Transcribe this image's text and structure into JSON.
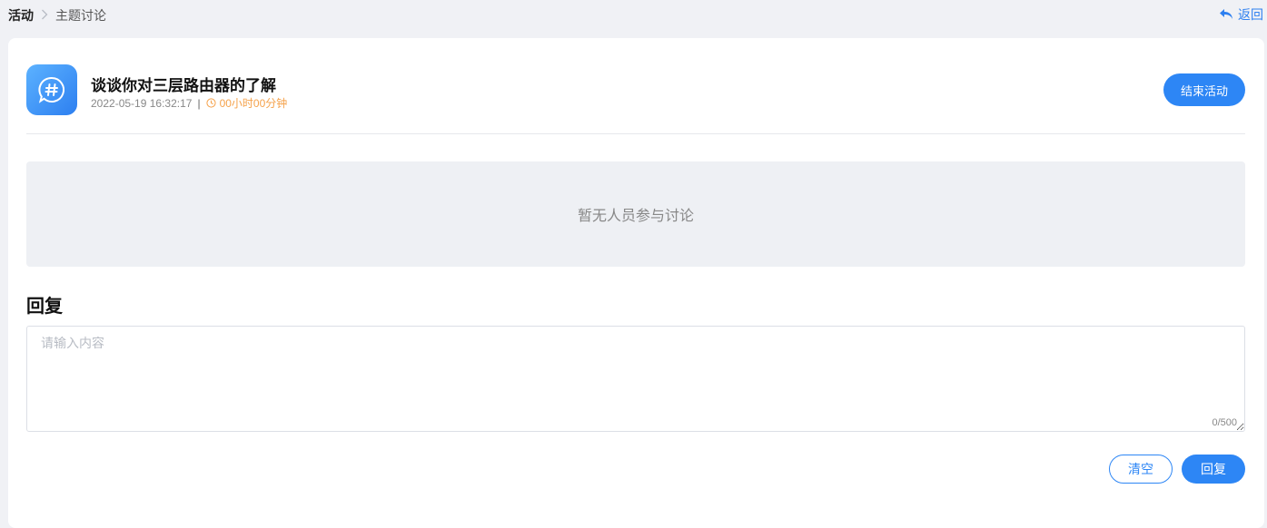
{
  "breadcrumb": {
    "root": "活动",
    "separator": ">",
    "current": "主题讨论"
  },
  "back": {
    "label": "返回",
    "icon": "reply-arrow-icon"
  },
  "topic": {
    "icon": "hashtag-chat-icon",
    "title": "谈谈你对三层路由器的了解",
    "date": "2022-05-19 16:32:17",
    "separator": "|",
    "duration": "00小时00分钟",
    "duration_icon": "clock-icon"
  },
  "actions": {
    "end_label": "结束活动"
  },
  "discussion": {
    "empty_text": "暂无人员参与讨论"
  },
  "reply": {
    "heading": "回复",
    "placeholder": "请输入内容",
    "value": "",
    "counter": "0/500",
    "clear_label": "清空",
    "submit_label": "回复"
  },
  "colors": {
    "accent": "#2d86f5",
    "duration": "#f5a24b",
    "background": "#f0f1f5"
  }
}
